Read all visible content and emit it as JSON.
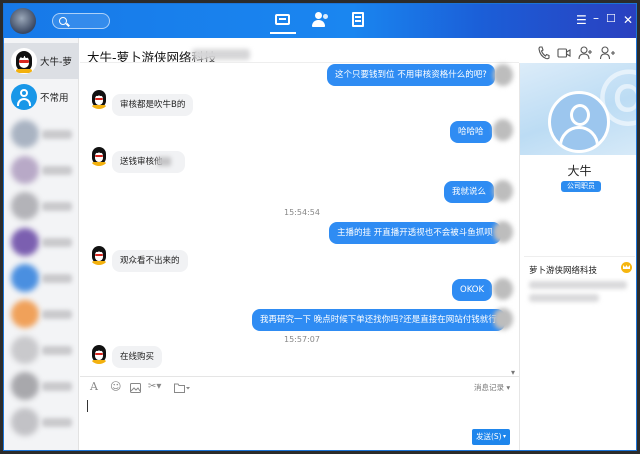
{
  "chat": {
    "title": "大牛-萝卜游侠网络科技",
    "timestamps": [
      "15:54:54",
      "15:57:07"
    ],
    "messages": [
      {
        "dir": "out",
        "text": "这个只要钱到位   不用审核资格什么的吧?"
      },
      {
        "dir": "in",
        "text": "审核都是吹牛B的"
      },
      {
        "dir": "out",
        "text": "哈哈哈"
      },
      {
        "dir": "in",
        "text": "送钱审核他"
      },
      {
        "dir": "out",
        "text": "我就说么"
      },
      {
        "dir": "out",
        "text": "主播的挂    开直播开透视也不会被斗鱼抓呗"
      },
      {
        "dir": "in",
        "text": "观众看不出来的"
      },
      {
        "dir": "out",
        "text": "OKOK"
      },
      {
        "dir": "out",
        "text": "我再研究一下   晚点时候下单还找你吗?还是直接在网站付钱就行"
      },
      {
        "dir": "in",
        "text": "在线购买"
      }
    ]
  },
  "sidebar": {
    "items": [
      {
        "label": "大牛-萝"
      },
      {
        "label": "不常用"
      }
    ]
  },
  "toolbar": {
    "history_label": "消息记录",
    "send_label": "发送(S)"
  },
  "profile": {
    "name": "大牛",
    "role": "公司职员",
    "company": "萝卜游侠网络科技"
  },
  "colors": {
    "accent": "#1a86f0",
    "bubble_out": "#2f8cf3",
    "bubble_in": "#f1f2f4"
  },
  "icons": [
    "search-icon",
    "chat-tab-icon",
    "contacts-tab-icon",
    "docs-tab-icon",
    "phone-icon",
    "video-icon",
    "add-user-icon",
    "more-icon",
    "font-icon",
    "emoji-icon",
    "image-icon",
    "scissors-icon",
    "folder-icon",
    "crown-icon"
  ]
}
